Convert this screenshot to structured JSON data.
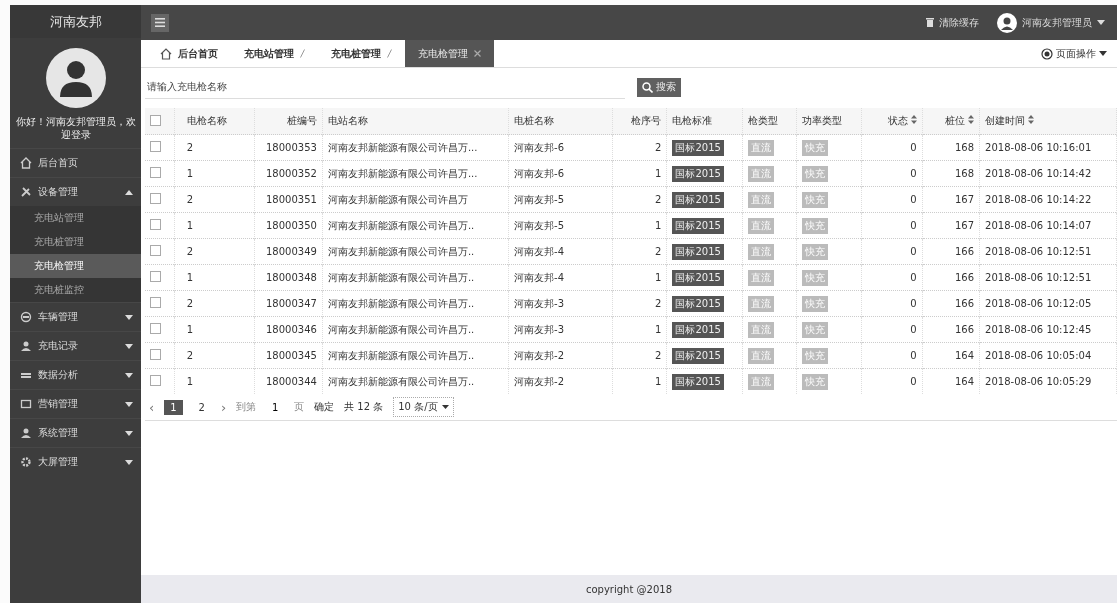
{
  "brand": "河南友邦",
  "topbar": {
    "clear_cache": "清除缓存",
    "user": "河南友邦管理员"
  },
  "sidebar": {
    "welcome": "你好！河南友邦管理员，欢迎登录",
    "items": [
      {
        "label": "后台首页",
        "expanded": false,
        "has_children": false
      },
      {
        "label": "设备管理",
        "expanded": true,
        "has_children": true,
        "children": [
          {
            "label": "充电站管理",
            "selected": false
          },
          {
            "label": "充电桩管理",
            "selected": false
          },
          {
            "label": "充电枪管理",
            "selected": true
          },
          {
            "label": "充电桩监控",
            "selected": false
          }
        ]
      },
      {
        "label": "车辆管理",
        "expanded": false,
        "has_children": true
      },
      {
        "label": "充电记录",
        "expanded": false,
        "has_children": true
      },
      {
        "label": "数据分析",
        "expanded": false,
        "has_children": true
      },
      {
        "label": "营销管理",
        "expanded": false,
        "has_children": true
      },
      {
        "label": "系统管理",
        "expanded": false,
        "has_children": true
      },
      {
        "label": "大屏管理",
        "expanded": false,
        "has_children": true
      }
    ]
  },
  "breadcrumb_tabs": [
    {
      "label": "后台首页",
      "kind": "home",
      "selected": false
    },
    {
      "label": "充电站管理",
      "kind": "tab",
      "selected": false
    },
    {
      "label": "充电桩管理",
      "kind": "tab",
      "selected": false
    },
    {
      "label": "充电枪管理",
      "kind": "tab",
      "selected": true
    }
  ],
  "page_actions": "页面操作",
  "search": {
    "placeholder": "请输入充电枪名称",
    "button": "搜索"
  },
  "table": {
    "header_checked": false,
    "columns": [
      {
        "label": "电枪名称",
        "kind": "text",
        "sortable": false
      },
      {
        "label": "桩编号",
        "kind": "num",
        "sortable": false
      },
      {
        "label": "电站名称",
        "kind": "text",
        "sortable": false
      },
      {
        "label": "电桩名称",
        "kind": "text",
        "sortable": false
      },
      {
        "label": "枪序号",
        "kind": "num",
        "sortable": false
      },
      {
        "label": "电枪标准",
        "kind": "badge-dark",
        "sortable": false
      },
      {
        "label": "枪类型",
        "kind": "badge-light",
        "sortable": false
      },
      {
        "label": "功率类型",
        "kind": "badge-light",
        "sortable": false
      },
      {
        "label": "状态",
        "kind": "num",
        "sortable": true
      },
      {
        "label": "桩位",
        "kind": "num",
        "sortable": true
      },
      {
        "label": "创建时间",
        "kind": "text",
        "sortable": true
      }
    ],
    "rows": [
      {
        "checked": false,
        "cells": [
          "2",
          "18000353",
          "河南友邦新能源有限公司许昌万...",
          "河南友邦-6",
          "2",
          "国标2015",
          "直流",
          "快充",
          "0",
          "168",
          "2018-08-06 10:16:01"
        ]
      },
      {
        "checked": false,
        "cells": [
          "1",
          "18000352",
          "河南友邦新能源有限公司许昌万...",
          "河南友邦-6",
          "1",
          "国标2015",
          "直流",
          "快充",
          "0",
          "168",
          "2018-08-06 10:14:42"
        ]
      },
      {
        "checked": false,
        "cells": [
          "2",
          "18000351",
          "河南友邦新能源有限公司许昌万",
          "河南友邦-5",
          "2",
          "国标2015",
          "直流",
          "快充",
          "0",
          "167",
          "2018-08-06 10:14:22"
        ]
      },
      {
        "checked": false,
        "cells": [
          "1",
          "18000350",
          "河南友邦新能源有限公司许昌万..",
          "河南友邦-5",
          "1",
          "国标2015",
          "直流",
          "快充",
          "0",
          "167",
          "2018-08-06 10:14:07"
        ]
      },
      {
        "checked": false,
        "cells": [
          "2",
          "18000349",
          "河南友邦新能源有限公司许昌万..",
          "河南友邦-4",
          "2",
          "国标2015",
          "直流",
          "快充",
          "0",
          "166",
          "2018-08-06 10:12:51"
        ]
      },
      {
        "checked": false,
        "cells": [
          "1",
          "18000348",
          "河南友邦新能源有限公司许昌万..",
          "河南友邦-4",
          "1",
          "国标2015",
          "直流",
          "快充",
          "0",
          "166",
          "2018-08-06 10:12:51"
        ]
      },
      {
        "checked": false,
        "cells": [
          "2",
          "18000347",
          "河南友邦新能源有限公司许昌万..",
          "河南友邦-3",
          "2",
          "国标2015",
          "直流",
          "快充",
          "0",
          "166",
          "2018-08-06 10:12:05"
        ]
      },
      {
        "checked": false,
        "cells": [
          "1",
          "18000346",
          "河南友邦新能源有限公司许昌万..",
          "河南友邦-3",
          "1",
          "国标2015",
          "直流",
          "快充",
          "0",
          "166",
          "2018-08-06 10:12:45"
        ]
      },
      {
        "checked": false,
        "cells": [
          "2",
          "18000345",
          "河南友邦新能源有限公司许昌万..",
          "河南友邦-2",
          "2",
          "国标2015",
          "直流",
          "快充",
          "0",
          "164",
          "2018-08-06 10:05:04"
        ]
      },
      {
        "checked": false,
        "cells": [
          "1",
          "18000344",
          "河南友邦新能源有限公司许昌万..",
          "河南友邦-2",
          "1",
          "国标2015",
          "直流",
          "快充",
          "0",
          "164",
          "2018-08-06 10:05:29"
        ]
      }
    ]
  },
  "pagination": {
    "prev": "‹",
    "pages": [
      {
        "label": "1",
        "selected": true
      },
      {
        "label": "2",
        "selected": false
      }
    ],
    "next": "›",
    "goto_label": "到第",
    "goto_value": "1",
    "page_unit": "页",
    "confirm": "确定",
    "total": "共 12 条",
    "page_size": "10 条/页"
  },
  "footer": "copyright @2018"
}
